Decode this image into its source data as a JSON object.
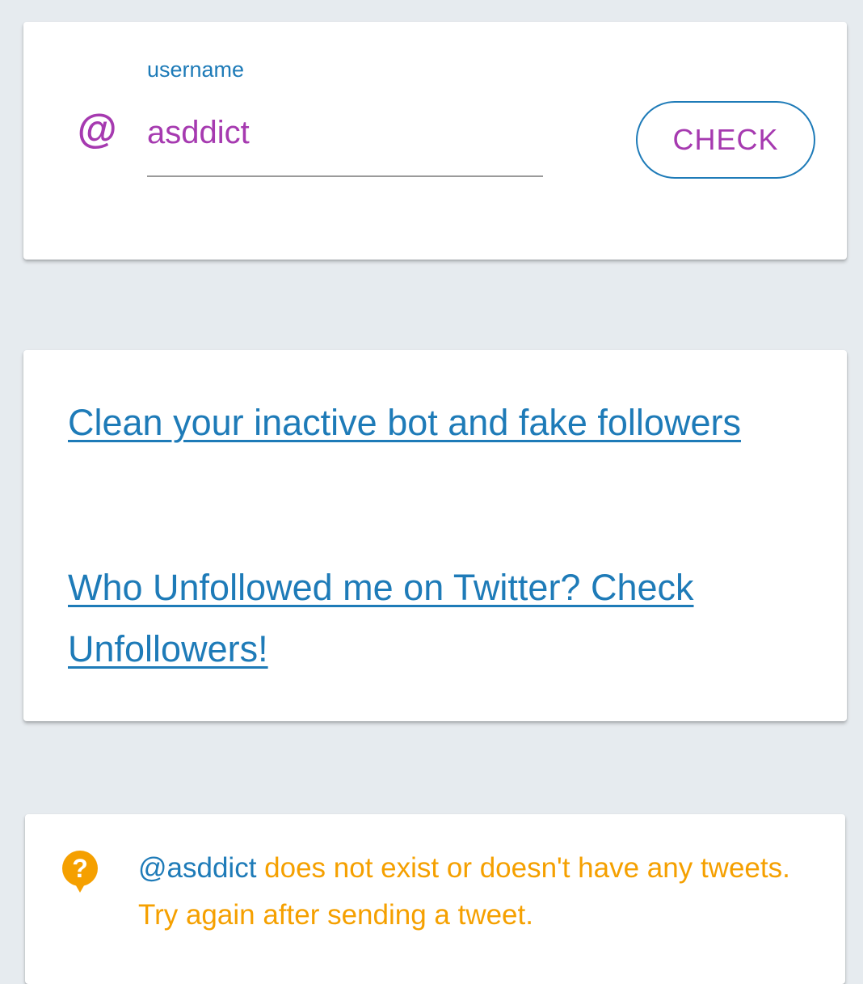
{
  "search": {
    "at_symbol": "@",
    "label": "username",
    "value": "asddict",
    "button_label": "CHECK"
  },
  "links": {
    "clean": "Clean your inactive bot and fake followers",
    "unfollowers": "Who Unfollowed me on Twitter? Check Unfollowers!"
  },
  "result": {
    "icon_glyph": "?",
    "icon": "question-bubble-icon",
    "username": "@asddict",
    "message": " does not exist or doesn't have any tweets. Try again after sending a tweet."
  },
  "colors": {
    "background": "#e6ebef",
    "accent_blue": "#1e7bb8",
    "accent_purple": "#a63ab0",
    "warning_orange": "#f5a000"
  }
}
